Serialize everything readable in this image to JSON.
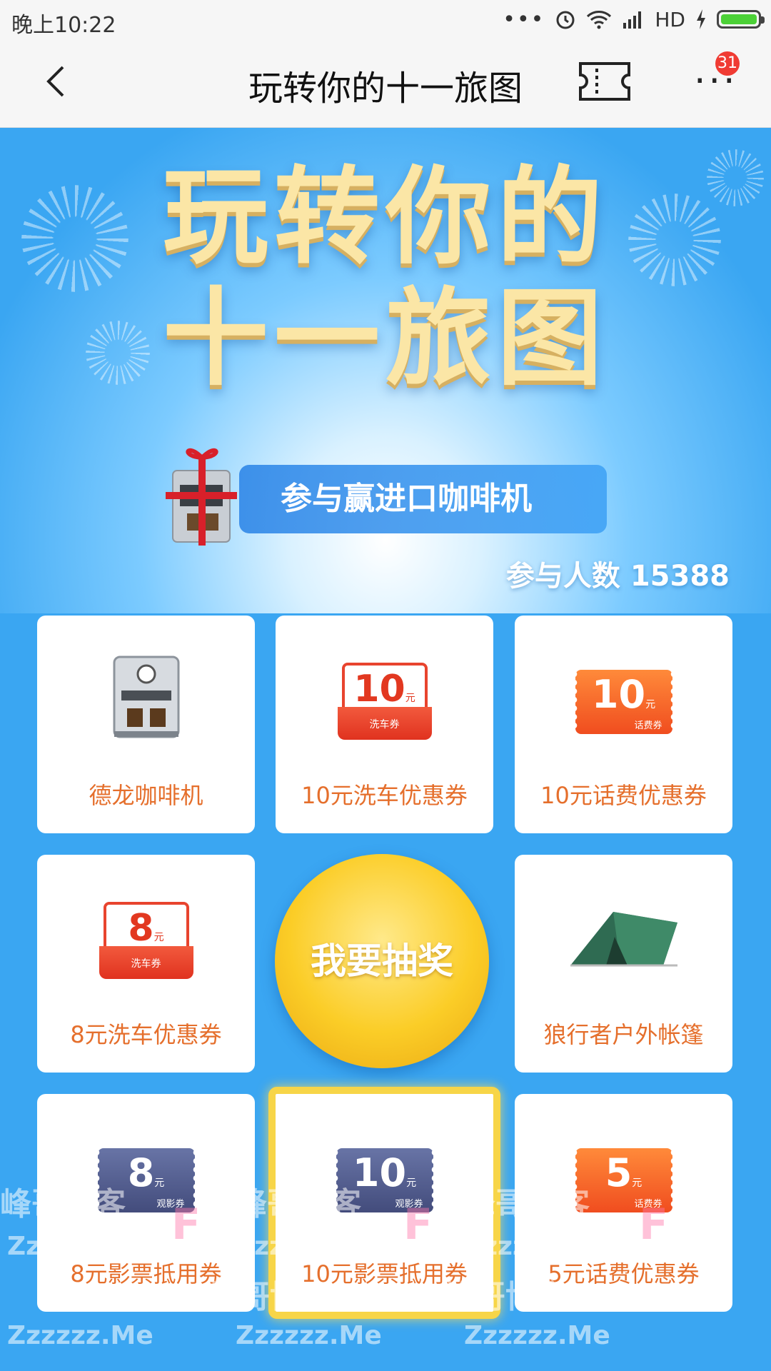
{
  "status_bar": {
    "time": "晚上10:22",
    "network": "HD"
  },
  "nav": {
    "title": "玩转你的十一旅图",
    "badge_count": "31"
  },
  "banner": {
    "title_line1": "玩转你的",
    "title_line2": "十一旅图",
    "promo": "参与赢进口咖啡机",
    "participants": "参与人数 15388"
  },
  "prizes": [
    {
      "label": "德龙咖啡机"
    },
    {
      "label": "10元洗车优惠券",
      "amount": "10",
      "unit": "元",
      "sub": "洗车券"
    },
    {
      "label": "10元话费优惠券",
      "amount": "10",
      "unit": "元",
      "sub": "话费券"
    },
    {
      "label": "8元洗车优惠券",
      "amount": "8",
      "unit": "元",
      "sub": "洗车券"
    },
    {
      "label": "狼行者户外帐篷"
    },
    {
      "label": "8元影票抵用券",
      "amount": "8",
      "unit": "元",
      "sub": "观影券"
    },
    {
      "label": "10元影票抵用券",
      "amount": "10",
      "unit": "元",
      "sub": "观影券"
    },
    {
      "label": "5元话费优惠券",
      "amount": "5",
      "unit": "元",
      "sub": "话费券"
    }
  ],
  "draw_button": "我要抽奖",
  "watermark": {
    "cn": "峰哥博客",
    "en": "Zzzzzz.Me",
    "logo": "F"
  }
}
